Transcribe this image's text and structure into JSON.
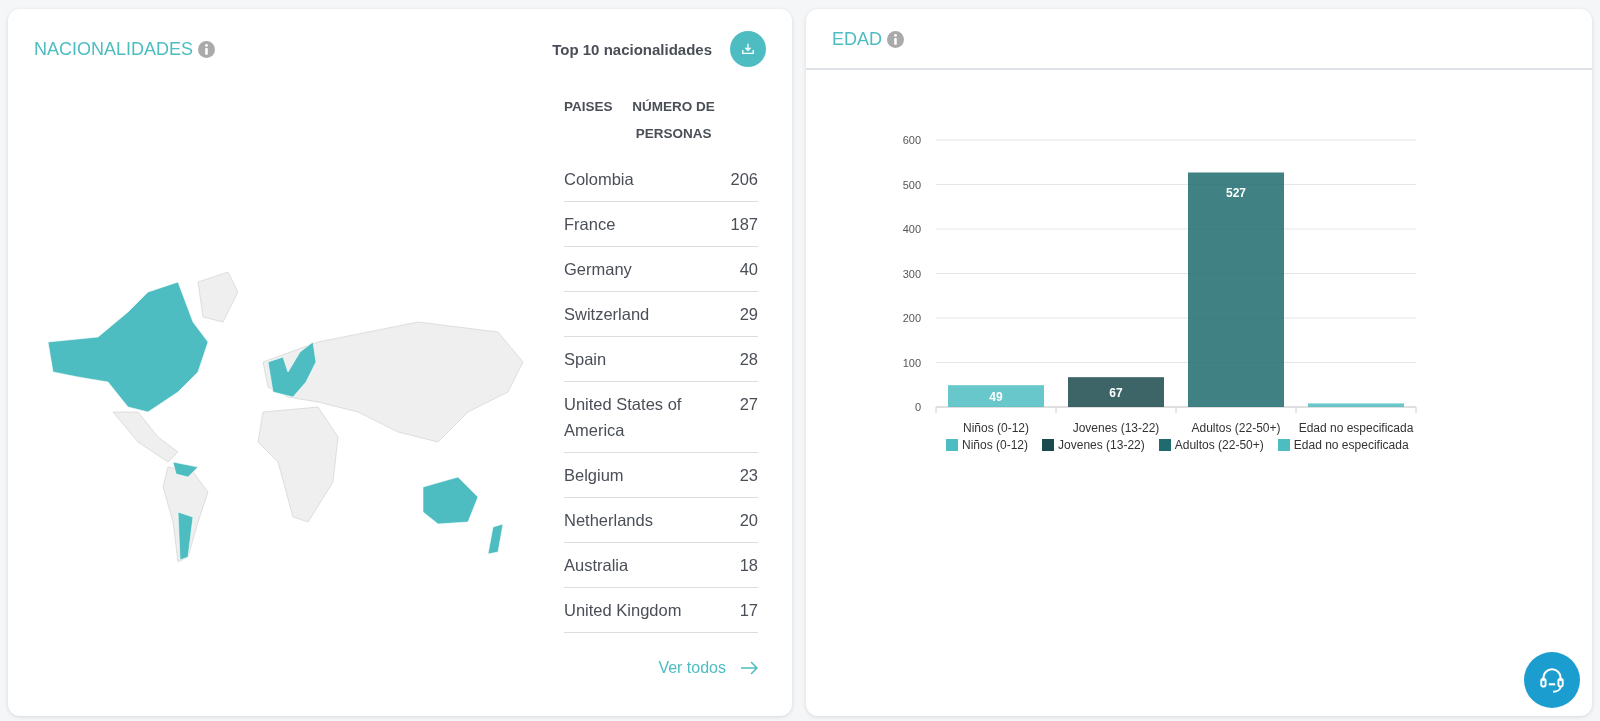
{
  "nationalities": {
    "title": "NACIONALIDADES",
    "subtitle": "Top 10 nacionalidades",
    "table": {
      "columns": [
        "PAISES",
        "NÚMERO DE PERSONAS"
      ],
      "rows": [
        {
          "country": "Colombia",
          "count": "206"
        },
        {
          "country": "France",
          "count": "187"
        },
        {
          "country": "Germany",
          "count": "40"
        },
        {
          "country": "Switzerland",
          "count": "29"
        },
        {
          "country": "Spain",
          "count": "28"
        },
        {
          "country": "United States of America",
          "count": "27"
        },
        {
          "country": "Belgium",
          "count": "23"
        },
        {
          "country": "Netherlands",
          "count": "20"
        },
        {
          "country": "Australia",
          "count": "18"
        },
        {
          "country": "United Kingdom",
          "count": "17"
        }
      ]
    },
    "link": "Ver todos"
  },
  "age": {
    "title": "EDAD",
    "chart_data": {
      "type": "bar",
      "categories": [
        "Niños (0-12)",
        "Jovenes (13-22)",
        "Adultos (22-50+)",
        "Edad no especificada"
      ],
      "ylim": [
        0,
        600
      ],
      "yticks": [
        0,
        100,
        200,
        300,
        400,
        500,
        600
      ],
      "grid": true,
      "value_labels": [
        "49",
        "67",
        "527",
        null
      ],
      "series": [
        {
          "name": "Niños (0-12)",
          "color": "#4dbdc2",
          "values": [
            49,
            null,
            null,
            null
          ]
        },
        {
          "name": "Jovenes (13-22)",
          "color": "#1b4a4e",
          "values": [
            null,
            67,
            null,
            null
          ]
        },
        {
          "name": "Adultos (22-50+)",
          "color": "#1f6b6d",
          "values": [
            null,
            null,
            527,
            null
          ]
        },
        {
          "name": "Edad no especificada",
          "color": "#4dbdc2",
          "values": [
            null,
            null,
            null,
            8
          ]
        }
      ]
    }
  }
}
